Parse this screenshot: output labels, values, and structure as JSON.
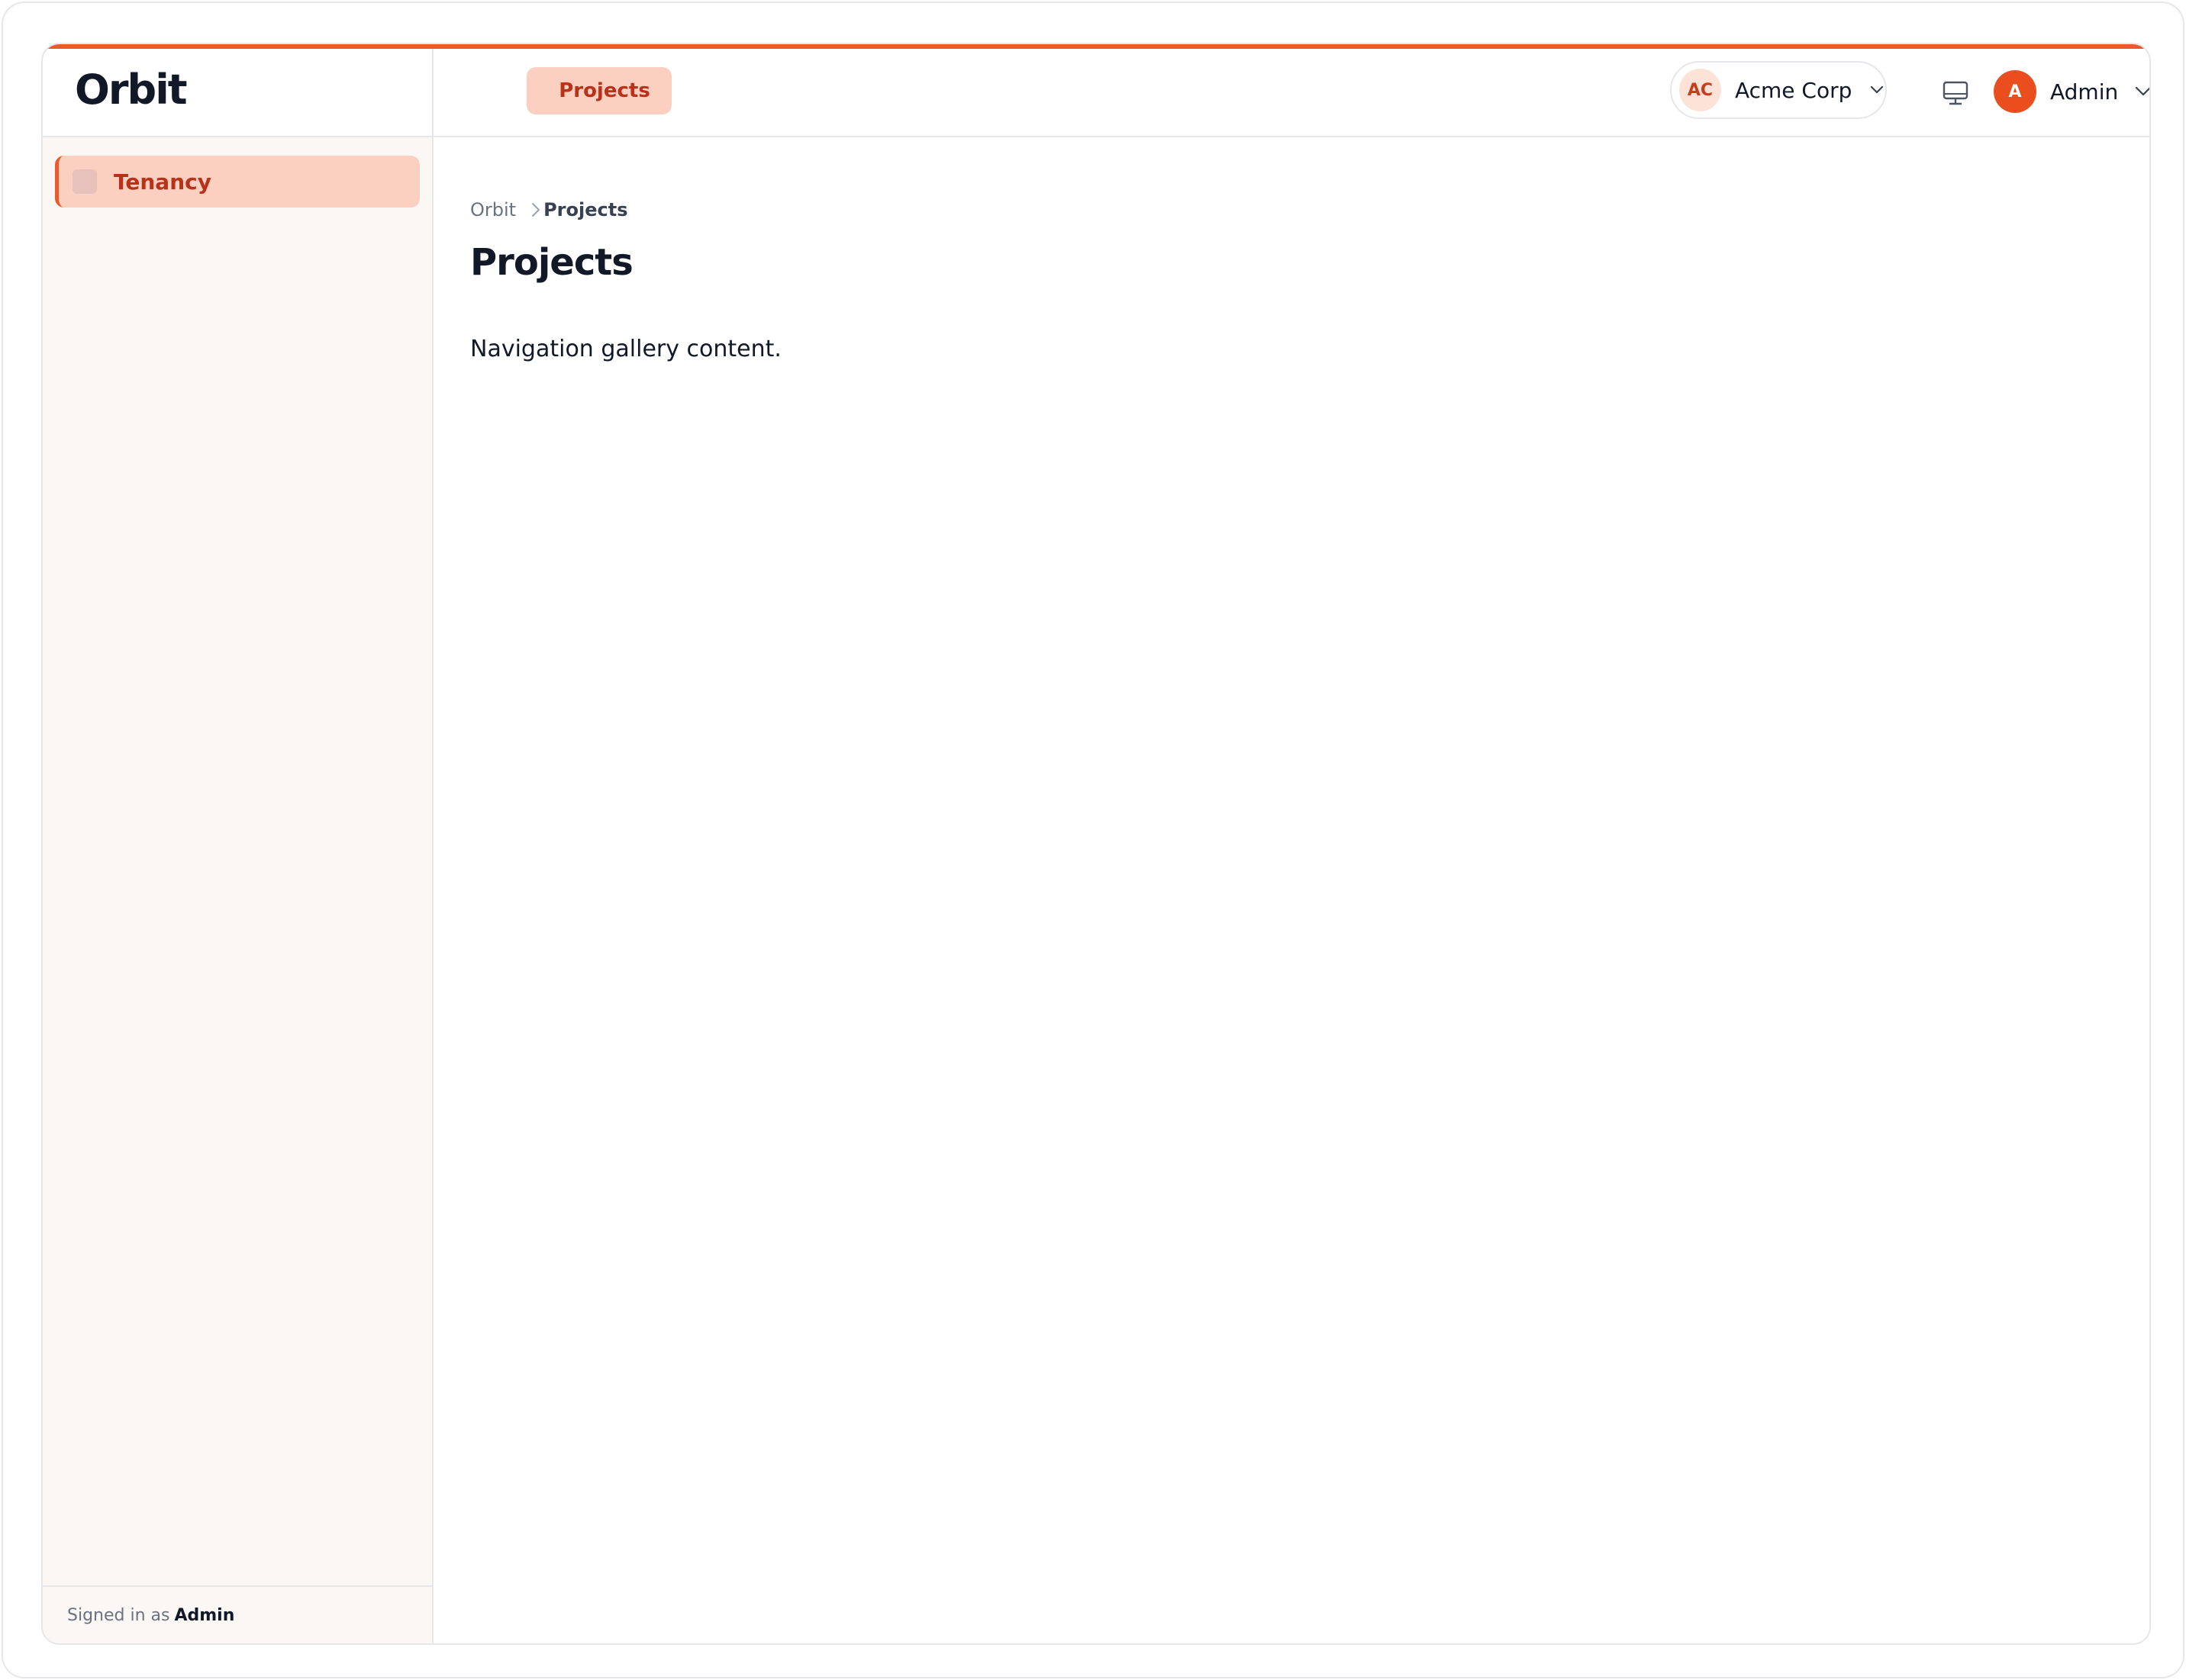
{
  "app": {
    "brand": "Orbit",
    "accent_color": "#ea5a2a"
  },
  "topnav": {
    "tabs": [
      {
        "label": "Projects",
        "active": true
      }
    ]
  },
  "tenant": {
    "initials": "AC",
    "name": "Acme Corp",
    "icon": "chevron-down-icon"
  },
  "device": {
    "icon": "monitor-icon"
  },
  "user": {
    "initial": "A",
    "name": "Admin",
    "icon": "chevron-down-icon"
  },
  "sidebar": {
    "items": [
      {
        "label": "Tenancy",
        "active": true
      }
    ],
    "footer": {
      "prefix": "Signed in as",
      "user": "Admin"
    }
  },
  "breadcrumb": {
    "root": "Orbit",
    "current": "Projects"
  },
  "main": {
    "title": "Projects",
    "body": "Navigation gallery content."
  }
}
